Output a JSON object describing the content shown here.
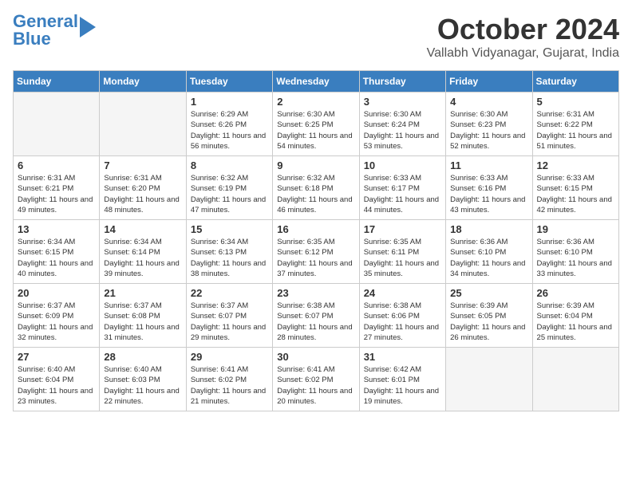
{
  "logo": {
    "line1": "General",
    "line2": "Blue"
  },
  "header": {
    "month": "October 2024",
    "location": "Vallabh Vidyanagar, Gujarat, India"
  },
  "days_of_week": [
    "Sunday",
    "Monday",
    "Tuesday",
    "Wednesday",
    "Thursday",
    "Friday",
    "Saturday"
  ],
  "weeks": [
    [
      {
        "day": "",
        "empty": true
      },
      {
        "day": "",
        "empty": true
      },
      {
        "day": "1",
        "sunrise": "Sunrise: 6:29 AM",
        "sunset": "Sunset: 6:26 PM",
        "daylight": "Daylight: 11 hours and 56 minutes."
      },
      {
        "day": "2",
        "sunrise": "Sunrise: 6:30 AM",
        "sunset": "Sunset: 6:25 PM",
        "daylight": "Daylight: 11 hours and 54 minutes."
      },
      {
        "day": "3",
        "sunrise": "Sunrise: 6:30 AM",
        "sunset": "Sunset: 6:24 PM",
        "daylight": "Daylight: 11 hours and 53 minutes."
      },
      {
        "day": "4",
        "sunrise": "Sunrise: 6:30 AM",
        "sunset": "Sunset: 6:23 PM",
        "daylight": "Daylight: 11 hours and 52 minutes."
      },
      {
        "day": "5",
        "sunrise": "Sunrise: 6:31 AM",
        "sunset": "Sunset: 6:22 PM",
        "daylight": "Daylight: 11 hours and 51 minutes."
      }
    ],
    [
      {
        "day": "6",
        "sunrise": "Sunrise: 6:31 AM",
        "sunset": "Sunset: 6:21 PM",
        "daylight": "Daylight: 11 hours and 49 minutes."
      },
      {
        "day": "7",
        "sunrise": "Sunrise: 6:31 AM",
        "sunset": "Sunset: 6:20 PM",
        "daylight": "Daylight: 11 hours and 48 minutes."
      },
      {
        "day": "8",
        "sunrise": "Sunrise: 6:32 AM",
        "sunset": "Sunset: 6:19 PM",
        "daylight": "Daylight: 11 hours and 47 minutes."
      },
      {
        "day": "9",
        "sunrise": "Sunrise: 6:32 AM",
        "sunset": "Sunset: 6:18 PM",
        "daylight": "Daylight: 11 hours and 46 minutes."
      },
      {
        "day": "10",
        "sunrise": "Sunrise: 6:33 AM",
        "sunset": "Sunset: 6:17 PM",
        "daylight": "Daylight: 11 hours and 44 minutes."
      },
      {
        "day": "11",
        "sunrise": "Sunrise: 6:33 AM",
        "sunset": "Sunset: 6:16 PM",
        "daylight": "Daylight: 11 hours and 43 minutes."
      },
      {
        "day": "12",
        "sunrise": "Sunrise: 6:33 AM",
        "sunset": "Sunset: 6:15 PM",
        "daylight": "Daylight: 11 hours and 42 minutes."
      }
    ],
    [
      {
        "day": "13",
        "sunrise": "Sunrise: 6:34 AM",
        "sunset": "Sunset: 6:15 PM",
        "daylight": "Daylight: 11 hours and 40 minutes."
      },
      {
        "day": "14",
        "sunrise": "Sunrise: 6:34 AM",
        "sunset": "Sunset: 6:14 PM",
        "daylight": "Daylight: 11 hours and 39 minutes."
      },
      {
        "day": "15",
        "sunrise": "Sunrise: 6:34 AM",
        "sunset": "Sunset: 6:13 PM",
        "daylight": "Daylight: 11 hours and 38 minutes."
      },
      {
        "day": "16",
        "sunrise": "Sunrise: 6:35 AM",
        "sunset": "Sunset: 6:12 PM",
        "daylight": "Daylight: 11 hours and 37 minutes."
      },
      {
        "day": "17",
        "sunrise": "Sunrise: 6:35 AM",
        "sunset": "Sunset: 6:11 PM",
        "daylight": "Daylight: 11 hours and 35 minutes."
      },
      {
        "day": "18",
        "sunrise": "Sunrise: 6:36 AM",
        "sunset": "Sunset: 6:10 PM",
        "daylight": "Daylight: 11 hours and 34 minutes."
      },
      {
        "day": "19",
        "sunrise": "Sunrise: 6:36 AM",
        "sunset": "Sunset: 6:10 PM",
        "daylight": "Daylight: 11 hours and 33 minutes."
      }
    ],
    [
      {
        "day": "20",
        "sunrise": "Sunrise: 6:37 AM",
        "sunset": "Sunset: 6:09 PM",
        "daylight": "Daylight: 11 hours and 32 minutes."
      },
      {
        "day": "21",
        "sunrise": "Sunrise: 6:37 AM",
        "sunset": "Sunset: 6:08 PM",
        "daylight": "Daylight: 11 hours and 31 minutes."
      },
      {
        "day": "22",
        "sunrise": "Sunrise: 6:37 AM",
        "sunset": "Sunset: 6:07 PM",
        "daylight": "Daylight: 11 hours and 29 minutes."
      },
      {
        "day": "23",
        "sunrise": "Sunrise: 6:38 AM",
        "sunset": "Sunset: 6:07 PM",
        "daylight": "Daylight: 11 hours and 28 minutes."
      },
      {
        "day": "24",
        "sunrise": "Sunrise: 6:38 AM",
        "sunset": "Sunset: 6:06 PM",
        "daylight": "Daylight: 11 hours and 27 minutes."
      },
      {
        "day": "25",
        "sunrise": "Sunrise: 6:39 AM",
        "sunset": "Sunset: 6:05 PM",
        "daylight": "Daylight: 11 hours and 26 minutes."
      },
      {
        "day": "26",
        "sunrise": "Sunrise: 6:39 AM",
        "sunset": "Sunset: 6:04 PM",
        "daylight": "Daylight: 11 hours and 25 minutes."
      }
    ],
    [
      {
        "day": "27",
        "sunrise": "Sunrise: 6:40 AM",
        "sunset": "Sunset: 6:04 PM",
        "daylight": "Daylight: 11 hours and 23 minutes."
      },
      {
        "day": "28",
        "sunrise": "Sunrise: 6:40 AM",
        "sunset": "Sunset: 6:03 PM",
        "daylight": "Daylight: 11 hours and 22 minutes."
      },
      {
        "day": "29",
        "sunrise": "Sunrise: 6:41 AM",
        "sunset": "Sunset: 6:02 PM",
        "daylight": "Daylight: 11 hours and 21 minutes."
      },
      {
        "day": "30",
        "sunrise": "Sunrise: 6:41 AM",
        "sunset": "Sunset: 6:02 PM",
        "daylight": "Daylight: 11 hours and 20 minutes."
      },
      {
        "day": "31",
        "sunrise": "Sunrise: 6:42 AM",
        "sunset": "Sunset: 6:01 PM",
        "daylight": "Daylight: 11 hours and 19 minutes."
      },
      {
        "day": "",
        "empty": true
      },
      {
        "day": "",
        "empty": true
      }
    ]
  ]
}
